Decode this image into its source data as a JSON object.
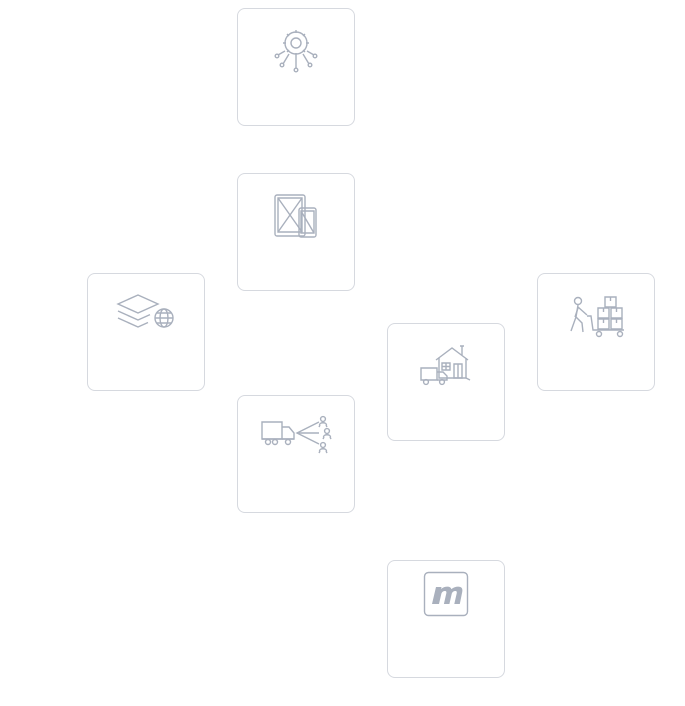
{
  "colors": {
    "tile_border": "#d6d9df",
    "icon_stroke": "#a9b0bd",
    "background": "#ffffff"
  },
  "tiles": [
    {
      "name": "tile-gear-network",
      "icon": "gear-network-icon",
      "label": ""
    },
    {
      "name": "tile-tablet-phone",
      "icon": "tablet-phone-icon",
      "label": ""
    },
    {
      "name": "tile-layers-globe",
      "icon": "layers-globe-icon",
      "label": ""
    },
    {
      "name": "tile-worker-dolly",
      "icon": "worker-dolly-icon",
      "label": ""
    },
    {
      "name": "tile-warehouse-truck",
      "icon": "warehouse-truck-icon",
      "label": ""
    },
    {
      "name": "tile-truck-distribution",
      "icon": "truck-distribution-icon",
      "label": ""
    },
    {
      "name": "tile-m-logo",
      "icon": "m-logo-icon",
      "label": ""
    }
  ]
}
